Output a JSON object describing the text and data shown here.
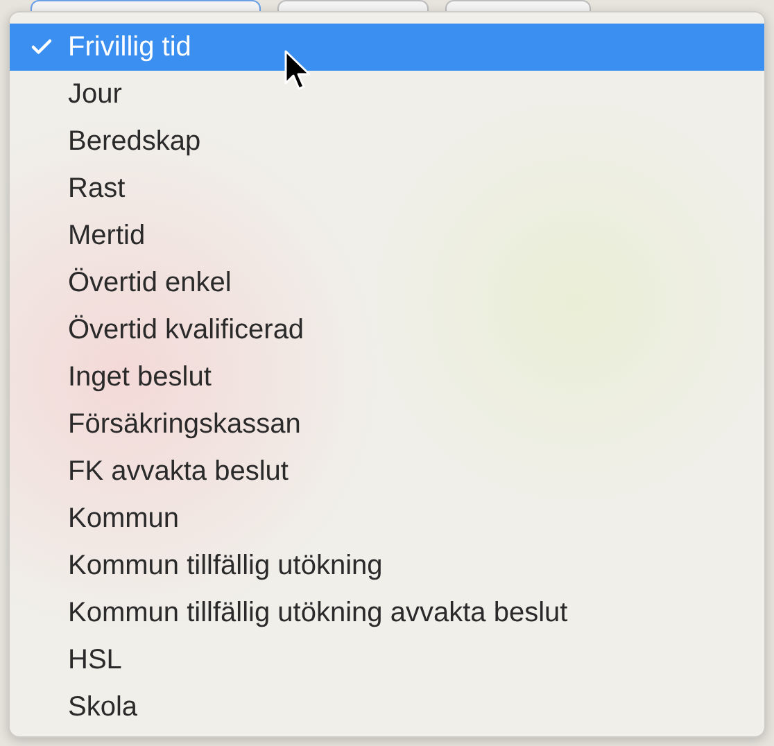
{
  "menu": {
    "items": [
      {
        "label": "Frivillig tid",
        "selected": true
      },
      {
        "label": "Jour",
        "selected": false
      },
      {
        "label": "Beredskap",
        "selected": false
      },
      {
        "label": "Rast",
        "selected": false
      },
      {
        "label": "Mertid",
        "selected": false
      },
      {
        "label": "Övertid enkel",
        "selected": false
      },
      {
        "label": "Övertid kvalificerad",
        "selected": false
      },
      {
        "label": "Inget beslut",
        "selected": false
      },
      {
        "label": "Försäkringskassan",
        "selected": false
      },
      {
        "label": "FK avvakta beslut",
        "selected": false
      },
      {
        "label": "Kommun",
        "selected": false
      },
      {
        "label": "Kommun tillfällig utökning",
        "selected": false
      },
      {
        "label": "Kommun tillfällig utökning avvakta beslut",
        "selected": false
      },
      {
        "label": "HSL",
        "selected": false
      },
      {
        "label": "Skola",
        "selected": false
      }
    ]
  }
}
